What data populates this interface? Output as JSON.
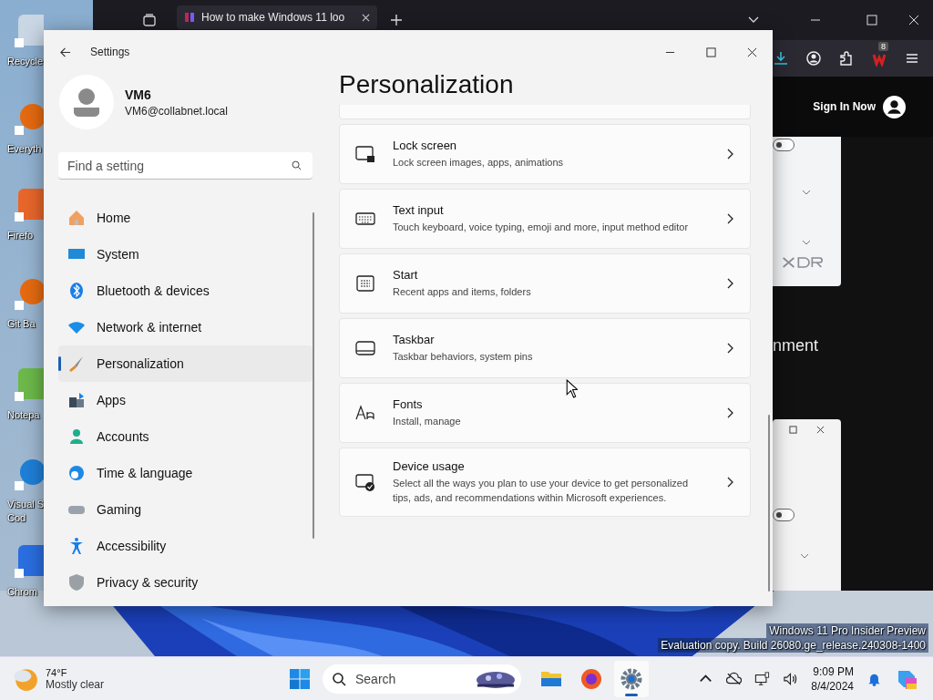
{
  "desktop_icons": [
    {
      "lines": [
        "Recycle"
      ]
    },
    {
      "lines": [
        "Everyth"
      ]
    },
    {
      "lines": [
        "Firefo"
      ]
    },
    {
      "lines": [
        "Git Ba"
      ]
    },
    {
      "lines": [
        "Notepa"
      ]
    },
    {
      "lines": [
        "Visual S",
        "Cod"
      ]
    },
    {
      "lines": [
        "Chrom"
      ]
    }
  ],
  "browser": {
    "tab_title": "How to make Windows 11 loo",
    "badge": "8",
    "sign_in": "Sign In Now",
    "page_text": "nment",
    "toggles": [
      {
        "on": false
      },
      {
        "on": false
      }
    ]
  },
  "settings": {
    "title": "Settings",
    "user": {
      "name": "VM6",
      "email": "VM6@collabnet.local"
    },
    "search": {
      "placeholder": "Find a setting"
    },
    "nav": [
      {
        "label": "Home",
        "selected": false
      },
      {
        "label": "System",
        "selected": false
      },
      {
        "label": "Bluetooth & devices",
        "selected": false
      },
      {
        "label": "Network & internet",
        "selected": false
      },
      {
        "label": "Personalization",
        "selected": true
      },
      {
        "label": "Apps",
        "selected": false
      },
      {
        "label": "Accounts",
        "selected": false
      },
      {
        "label": "Time & language",
        "selected": false
      },
      {
        "label": "Gaming",
        "selected": false
      },
      {
        "label": "Accessibility",
        "selected": false
      },
      {
        "label": "Privacy & security",
        "selected": false
      }
    ],
    "heading": "Personalization",
    "cards": [
      {
        "title": "Lock screen",
        "subtitle": "Lock screen images, apps, animations"
      },
      {
        "title": "Text input",
        "subtitle": "Touch keyboard, voice typing, emoji and more, input method editor"
      },
      {
        "title": "Start",
        "subtitle": "Recent apps and items, folders"
      },
      {
        "title": "Taskbar",
        "subtitle": "Taskbar behaviors, system pins"
      },
      {
        "title": "Fonts",
        "subtitle": "Install, manage"
      },
      {
        "title": "Device usage",
        "subtitle": "Select all the ways you plan to use your device to get personalized tips, ads, and recommendations within Microsoft experiences."
      }
    ]
  },
  "watermark": [
    "Windows 11 Pro Insider Preview",
    "Evaluation copy. Build 26080.ge_release.240308-1400"
  ],
  "taskbar": {
    "weather": {
      "temp": "74°F",
      "condition": "Mostly clear"
    },
    "search": {
      "placeholder": "Search"
    },
    "apps": [
      {
        "kind": "files",
        "selected": false
      },
      {
        "kind": "firefox",
        "selected": false
      },
      {
        "kind": "settings",
        "selected": true
      }
    ],
    "clock": {
      "time": "9:09 PM",
      "date": "8/4/2024"
    }
  }
}
